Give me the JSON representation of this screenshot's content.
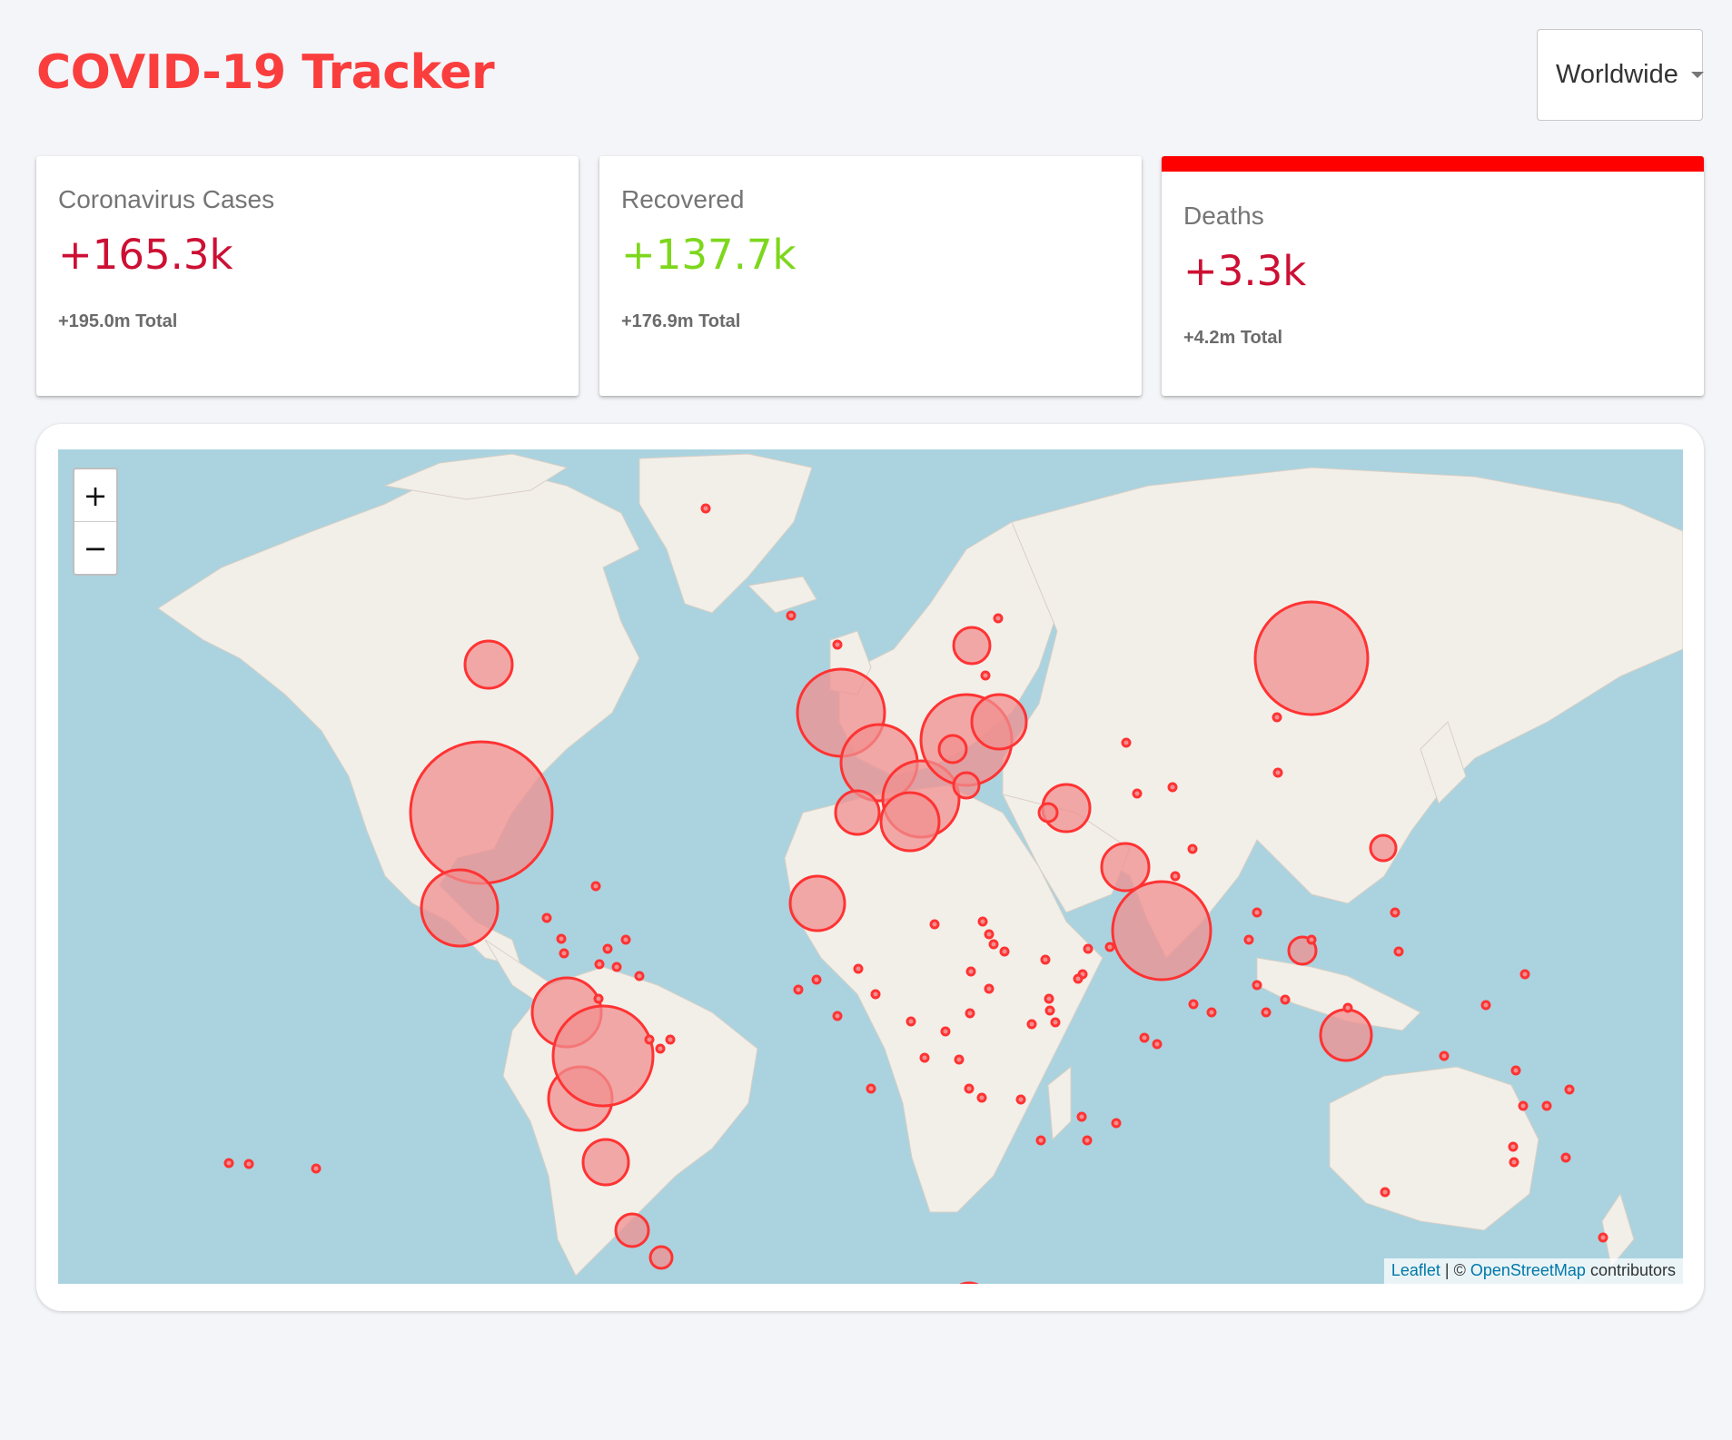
{
  "header": {
    "title": "COVID-19 Tracker",
    "country_select": {
      "selected": "Worldwide"
    }
  },
  "cards": [
    {
      "label": "Coronavirus Cases",
      "value": "+165.3k",
      "total": "+195.0m Total",
      "value_color": "#cc1034",
      "selected": false
    },
    {
      "label": "Recovered",
      "value": "+137.7k",
      "total": "+176.9m Total",
      "value_color": "#7dd71d",
      "selected": false
    },
    {
      "label": "Deaths",
      "value": "+3.3k",
      "total": "+4.2m Total",
      "value_color": "#cc1034",
      "selected": true
    }
  ],
  "map": {
    "zoom_in": "+",
    "zoom_out": "−",
    "attribution": {
      "leaflet": "Leaflet",
      "separator": " | © ",
      "osm": "OpenStreetMap",
      "contributors": " contributors"
    },
    "colors": {
      "water": "#aad3df",
      "land": "#f2efe9",
      "circle_fill": "#f08f8f",
      "circle_stroke": "#ff3333"
    }
  }
}
